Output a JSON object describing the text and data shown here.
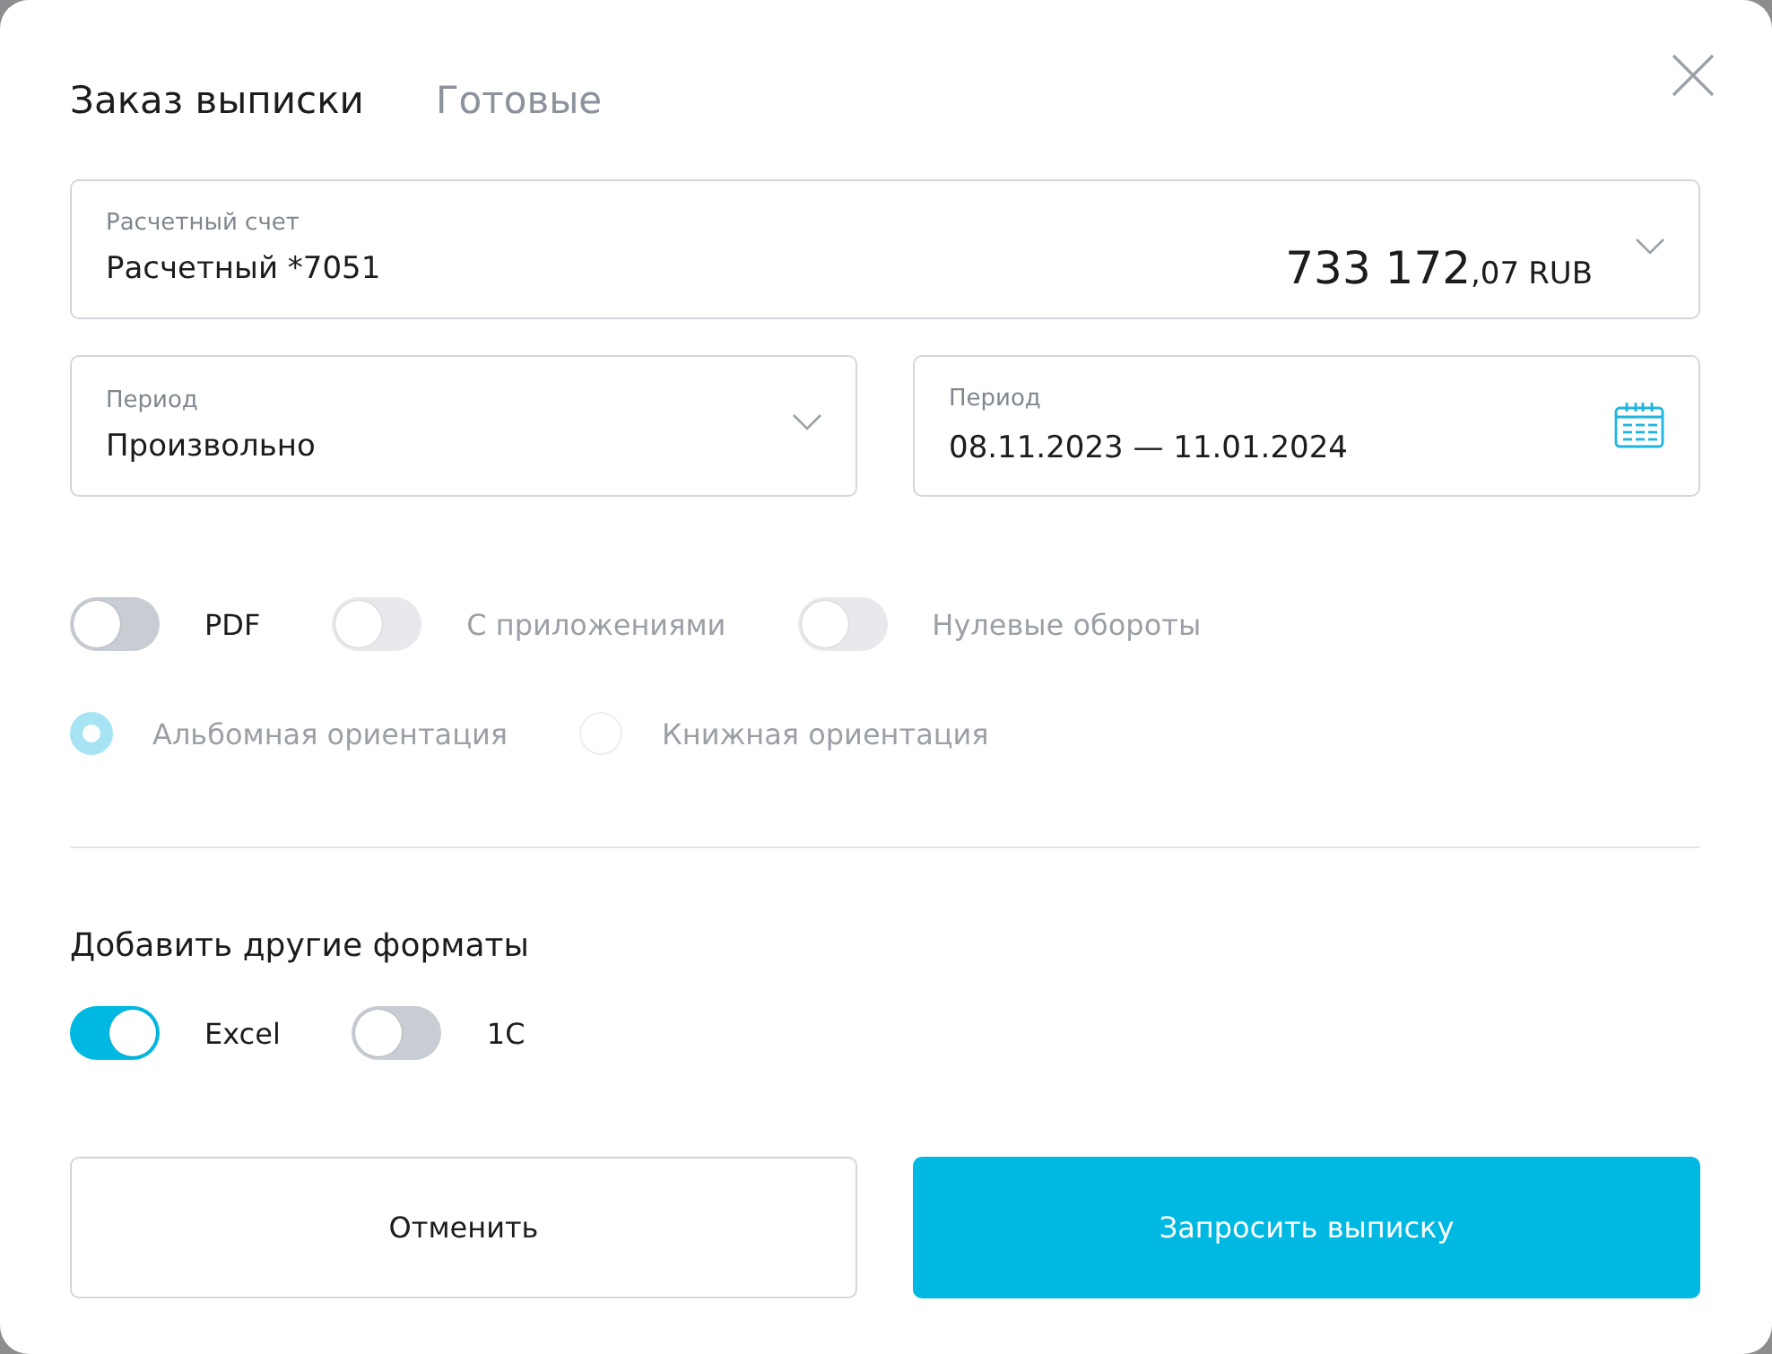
{
  "tabs": [
    {
      "label": "Заказ выписки",
      "selected": true
    },
    {
      "label": "Готовые",
      "selected": false
    }
  ],
  "account_field": {
    "label": "Расчетный счет",
    "value": "Расчетный *7051",
    "balance": {
      "integer": "733 172",
      "fraction": ",07",
      "currency": "RUB"
    }
  },
  "period_fields": [
    {
      "kind": "select",
      "label": "Период",
      "value": "Произвольно"
    },
    {
      "kind": "date_range",
      "label": "Период",
      "value": "08.11.2023 — 11.01.2024"
    }
  ],
  "options": [
    {
      "label": "PDF",
      "on": false,
      "disabled": false
    },
    {
      "label": "С приложениями",
      "on": false,
      "disabled": true
    },
    {
      "label": "Нулевые обороты",
      "on": false,
      "disabled": true
    }
  ],
  "orientation": [
    {
      "label": "Альбомная ориентация",
      "selected": true,
      "disabled": true
    },
    {
      "label": "Книжная ориентация",
      "selected": false,
      "disabled": true
    }
  ],
  "other_formats": {
    "title": "Добавить другие форматы",
    "toggles": [
      {
        "label": "Excel",
        "on": true,
        "disabled": false
      },
      {
        "label": "1C",
        "on": false,
        "disabled": false
      }
    ]
  },
  "buttons": [
    {
      "label": "Отменить",
      "kind": "secondary"
    },
    {
      "label": "Запросить выписку",
      "kind": "primary"
    }
  ]
}
